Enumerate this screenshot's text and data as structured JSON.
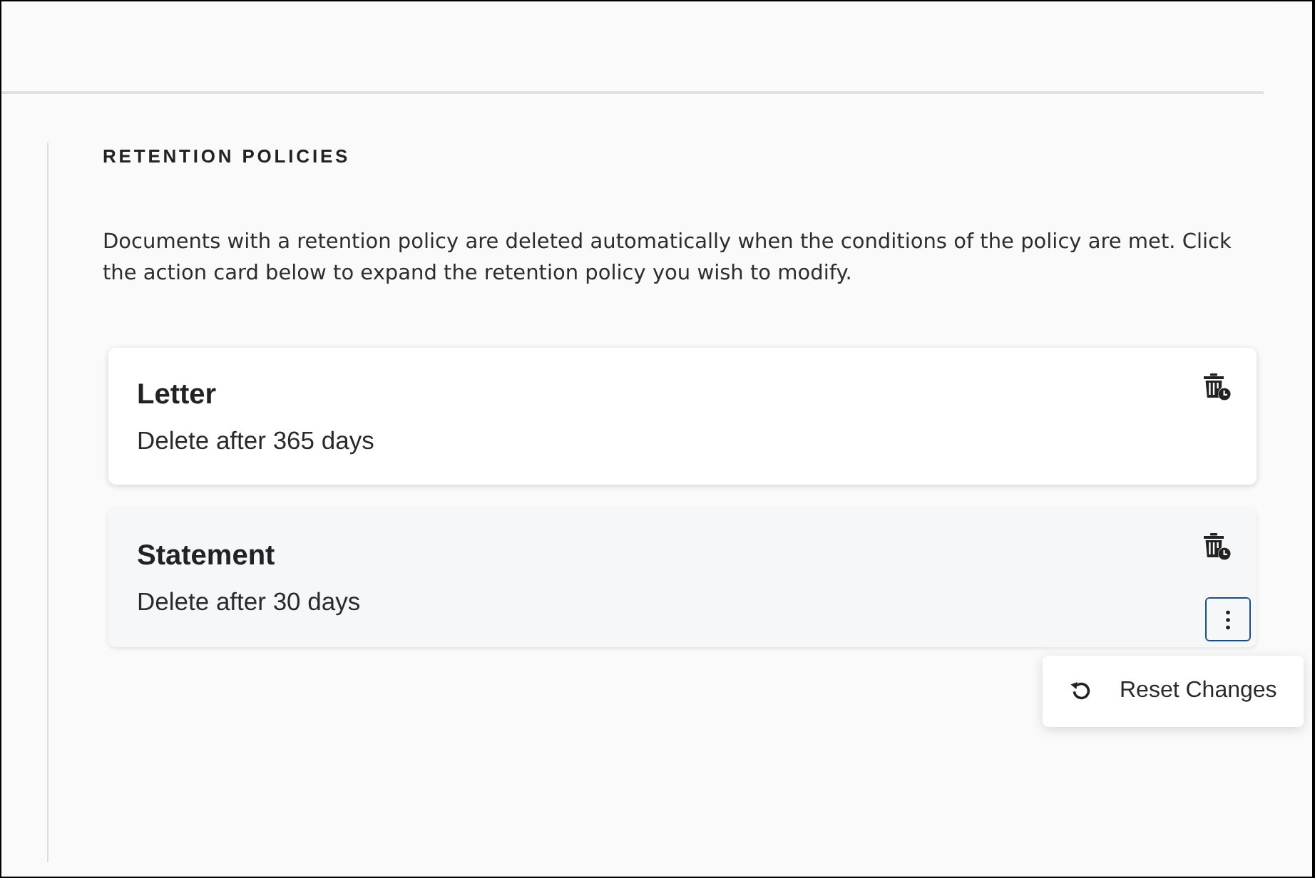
{
  "section": {
    "title": "RETENTION POLICIES",
    "description": "Documents with a retention policy are deleted automatically when the conditions of the policy are met. Click the action card below to expand the retention policy you wish to modify."
  },
  "policies": [
    {
      "title": "Letter",
      "subtitle": "Delete after 365 days",
      "selected": false
    },
    {
      "title": "Statement",
      "subtitle": "Delete after 30 days",
      "selected": true,
      "menu": {
        "items": [
          {
            "label": "Reset Changes"
          }
        ]
      }
    }
  ]
}
